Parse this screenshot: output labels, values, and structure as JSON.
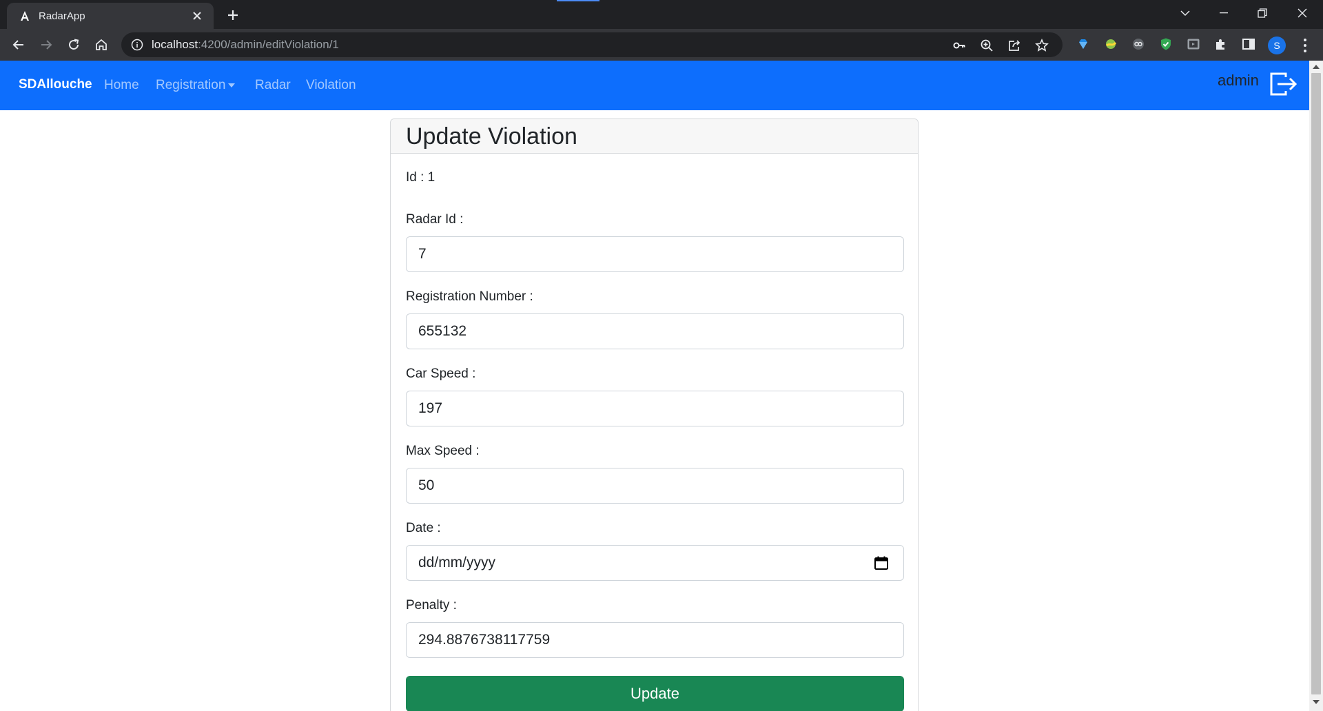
{
  "browser": {
    "tab_title": "RadarApp",
    "url_host": "localhost",
    "url_path": ":4200/admin/editViolation/1",
    "profile_initial": "S"
  },
  "navbar": {
    "brand": "SDAllouche",
    "links": [
      "Home",
      "Registration",
      "Radar",
      "Violation"
    ],
    "user": "admin",
    "color": "#0d6efd"
  },
  "form": {
    "title": "Update Violation",
    "id_label": "Id : 1",
    "fields": [
      {
        "label": "Radar Id :",
        "value": "7"
      },
      {
        "label": "Registration Number :",
        "value": "655132"
      },
      {
        "label": "Car Speed :",
        "value": "197"
      },
      {
        "label": "Max Speed :",
        "value": "50"
      },
      {
        "label": "Date :",
        "value": "dd/mm/yyyy"
      },
      {
        "label": "Penalty :",
        "value": "294.8876738117759"
      }
    ],
    "submit_label": "Update",
    "submit_color": "#198754"
  }
}
